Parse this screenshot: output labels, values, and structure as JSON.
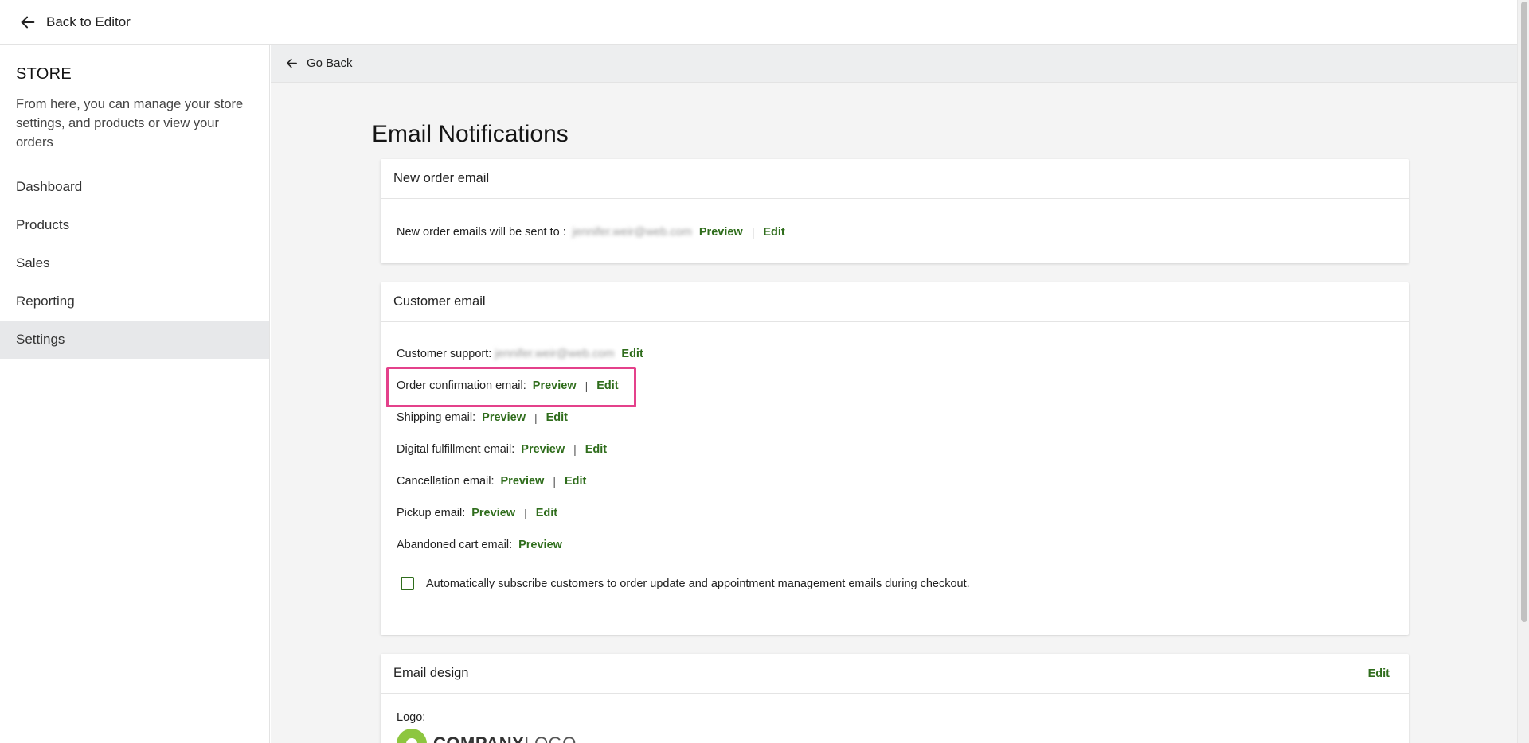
{
  "topbar": {
    "back_label": "Back to Editor"
  },
  "sidebar": {
    "title": "STORE",
    "description": "From here, you can manage your store settings, and products or view your orders",
    "items": [
      {
        "label": "Dashboard"
      },
      {
        "label": "Products"
      },
      {
        "label": "Sales"
      },
      {
        "label": "Reporting"
      },
      {
        "label": "Settings",
        "active": true
      }
    ]
  },
  "main": {
    "go_back_label": "Go Back",
    "page_title": "Email Notifications",
    "new_order_card": {
      "title": "New order email",
      "text": "New order emails will be sent to :",
      "email": "jennifer.weir@web.com",
      "preview_label": "Preview",
      "edit_label": "Edit"
    },
    "customer_card": {
      "title": "Customer email",
      "support_label": "Customer support:",
      "support_email": "jennifer.weir@web.com",
      "support_edit": "Edit",
      "rows": [
        {
          "label": "Order confirmation email:",
          "preview": "Preview",
          "edit": "Edit"
        },
        {
          "label": "Shipping email:",
          "preview": "Preview",
          "edit": "Edit"
        },
        {
          "label": "Digital fulfillment email:",
          "preview": "Preview",
          "edit": "Edit"
        },
        {
          "label": "Cancellation email:",
          "preview": "Preview",
          "edit": "Edit"
        },
        {
          "label": "Pickup email:",
          "preview": "Preview",
          "edit": "Edit"
        },
        {
          "label": "Abandoned cart email:",
          "preview": "Preview"
        }
      ],
      "checkbox_label": "Automatically subscribe customers to order update and appointment management emails during checkout.",
      "checkbox_checked": false
    },
    "design_card": {
      "title": "Email design",
      "edit_label": "Edit",
      "logo_label": "Logo:",
      "logo_text_bold": "COMPANY",
      "logo_text_thin": "LOGO"
    }
  },
  "colors": {
    "link_green": "#2f6d1c",
    "highlight_pink": "#e4418b",
    "active_nav_bg": "#e7e8ea",
    "logo_green": "#8dc63f"
  },
  "icons": {
    "back": "arrow-left-icon",
    "go_back": "arrow-left-icon",
    "logo": "company-logo-icon"
  }
}
